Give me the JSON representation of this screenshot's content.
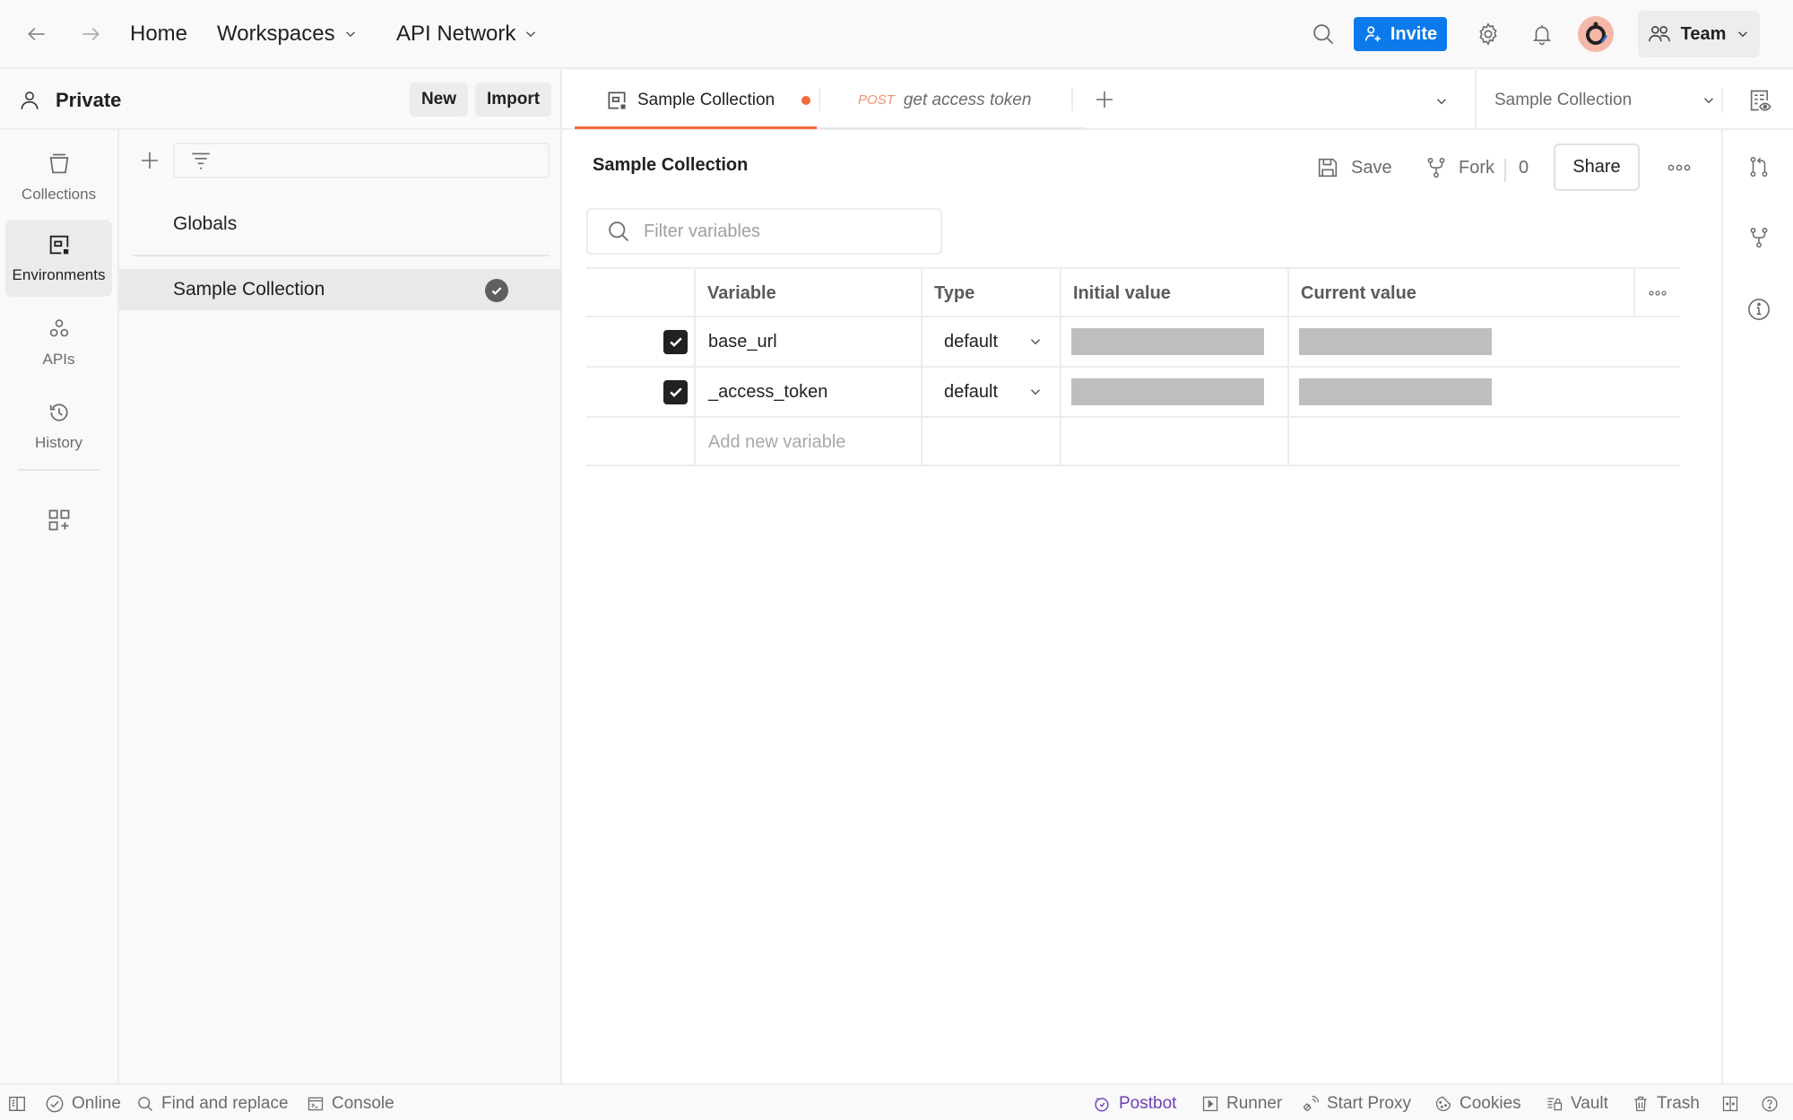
{
  "header": {
    "back_icon": "arrow-left-icon",
    "forward_icon": "arrow-right-icon",
    "home": "Home",
    "workspaces": "Workspaces",
    "api_network": "API Network",
    "invite": "Invite",
    "team": "Team",
    "colors": {
      "invite_bg": "#0c7aeb",
      "avatar_bg": "#f5b8a8"
    }
  },
  "workspace": {
    "name": "Private",
    "new_label": "New",
    "import_label": "Import"
  },
  "rail": {
    "items": [
      {
        "label": "Collections",
        "icon": "collections-icon",
        "active": false
      },
      {
        "label": "Environments",
        "icon": "environments-icon",
        "active": true
      },
      {
        "label": "APIs",
        "icon": "apis-icon",
        "active": false
      },
      {
        "label": "History",
        "icon": "history-icon",
        "active": false
      }
    ],
    "more_icon": "configure-sidebar-icon"
  },
  "environments": {
    "search_placeholder": "",
    "items": [
      {
        "label": "Globals",
        "active": false,
        "selected": false
      },
      {
        "label": "Sample Collection",
        "active": true,
        "selected": true
      }
    ]
  },
  "tabs": {
    "items": [
      {
        "label": "Sample Collection",
        "icon": "environment-icon",
        "active": true,
        "unsaved": true
      },
      {
        "method": "POST",
        "label": "get access token",
        "active": false
      }
    ],
    "env_selector": "Sample Collection",
    "colors": {
      "active_underline": "#f26b3a",
      "method_post": "#e8956f"
    }
  },
  "content": {
    "title": "Sample Collection",
    "save": "Save",
    "fork": "Fork",
    "fork_count": "0",
    "share": "Share",
    "filter_placeholder": "Filter variables",
    "table": {
      "columns": [
        "Variable",
        "Type",
        "Initial value",
        "Current value"
      ],
      "rows": [
        {
          "enabled": true,
          "variable": "base_url",
          "type": "default",
          "initial_value_masked": true,
          "current_value_masked": true
        },
        {
          "enabled": true,
          "variable": "_access_token",
          "type": "default",
          "initial_value_masked": true,
          "current_value_masked": true
        }
      ],
      "add_placeholder": "Add new variable"
    }
  },
  "right_rail": {
    "icons": [
      "pull-request-icon",
      "fork-icon",
      "info-icon"
    ]
  },
  "statusbar": {
    "left": [
      {
        "label": "",
        "icon": "toggle-sidebar-icon"
      },
      {
        "label": "Online",
        "icon": "online-check-icon"
      },
      {
        "label": "Find and replace",
        "icon": "search-icon"
      },
      {
        "label": "Console",
        "icon": "console-icon"
      }
    ],
    "right": [
      {
        "label": "Postbot",
        "icon": "postbot-icon"
      },
      {
        "label": "Runner",
        "icon": "runner-icon"
      },
      {
        "label": "Start Proxy",
        "icon": "proxy-icon"
      },
      {
        "label": "Cookies",
        "icon": "cookie-icon"
      },
      {
        "label": "Vault",
        "icon": "vault-icon"
      },
      {
        "label": "Trash",
        "icon": "trash-icon"
      },
      {
        "label": "",
        "icon": "two-pane-icon"
      },
      {
        "label": "",
        "icon": "help-icon"
      }
    ],
    "colors": {
      "postbot": "#6e3fb5"
    }
  }
}
